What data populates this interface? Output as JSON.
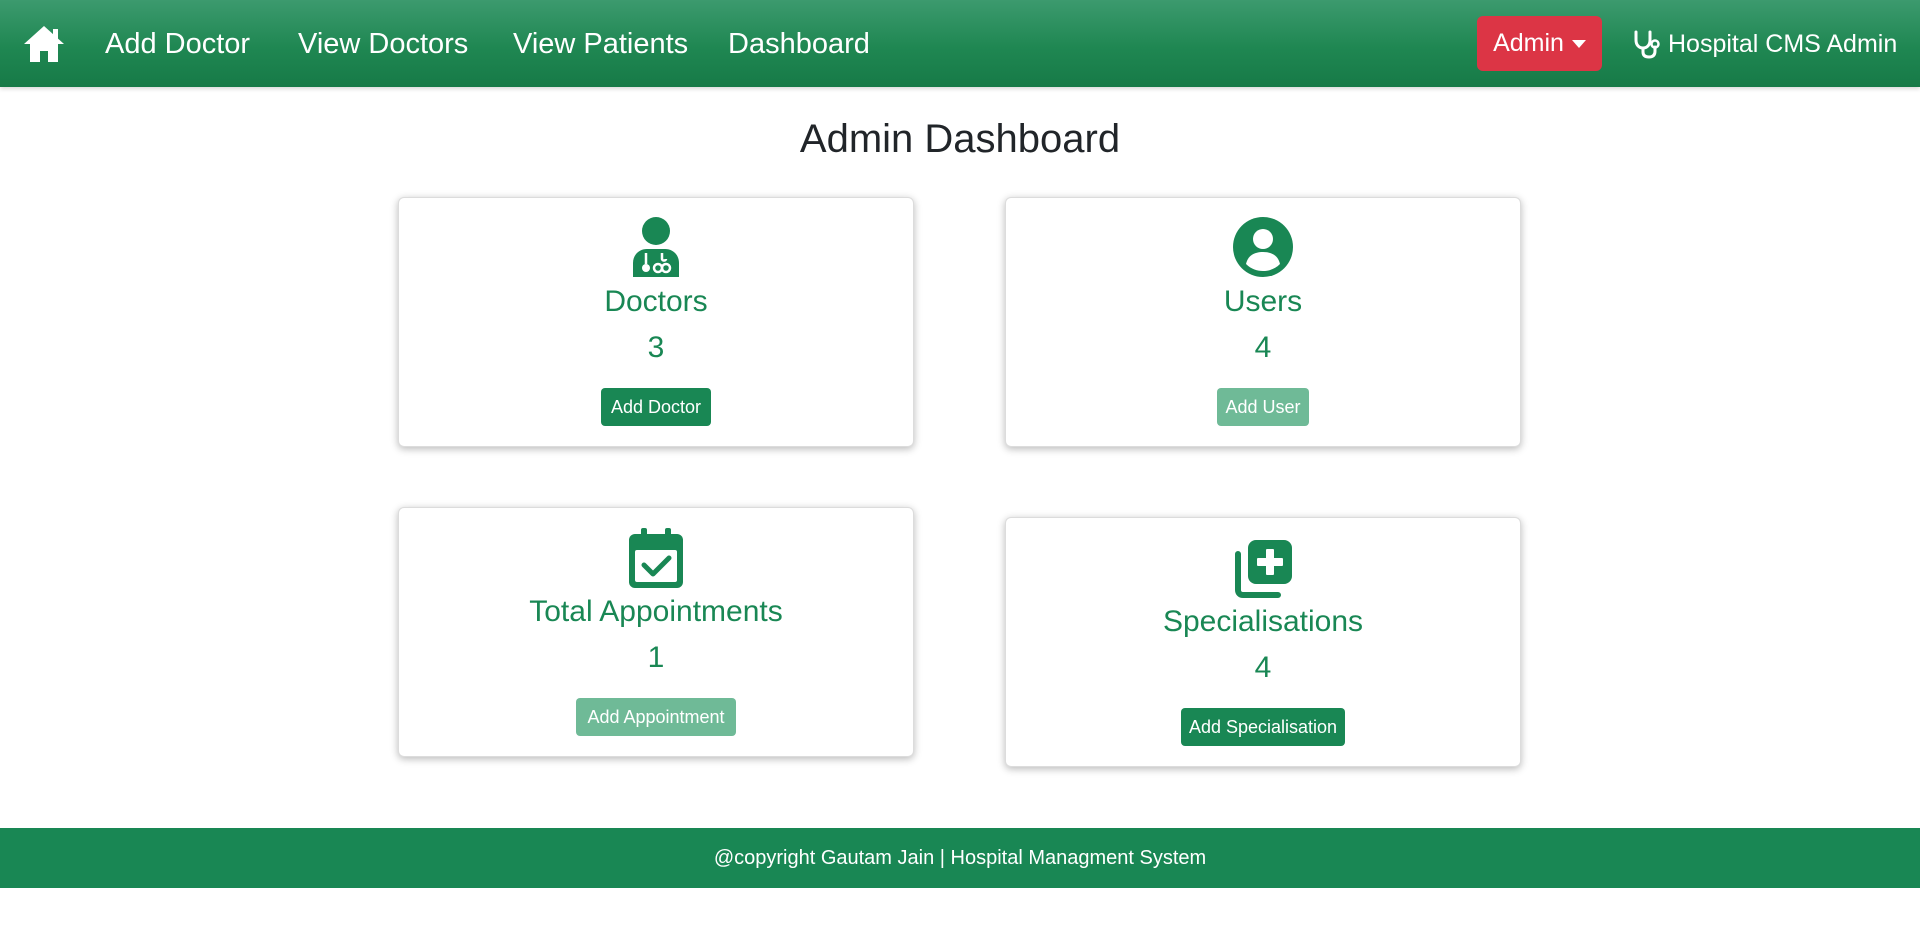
{
  "nav": {
    "home_icon": "house-icon",
    "links": [
      "Add Doctor",
      "View Doctors",
      "View Patients",
      "Dashboard"
    ],
    "admin_label": "Admin",
    "brand_icon": "stethoscope-icon",
    "brand_label": "Hospital CMS Admin"
  },
  "page": {
    "title": "Admin Dashboard"
  },
  "cards": [
    {
      "icon": "user-doctor-icon",
      "title": "Doctors",
      "count": "3",
      "button": "Add Doctor"
    },
    {
      "icon": "circle-user-icon",
      "title": "Users",
      "count": "4",
      "button": "Add User"
    },
    {
      "icon": "calendar-check-icon",
      "title": "Total Appointments",
      "count": "1",
      "button": "Add Appointment"
    },
    {
      "icon": "notes-medical-icon",
      "title": "Specialisations",
      "count": "4",
      "button": "Add Specialisation"
    }
  ],
  "footer": {
    "text": "@copyright Gautam Jain | Hospital Managment System"
  },
  "colors": {
    "navbar": "#1f8752",
    "accent": "#198754",
    "accent_faded": "#6fba97",
    "admin_button": "#dc3545",
    "title_text": "#212529"
  }
}
